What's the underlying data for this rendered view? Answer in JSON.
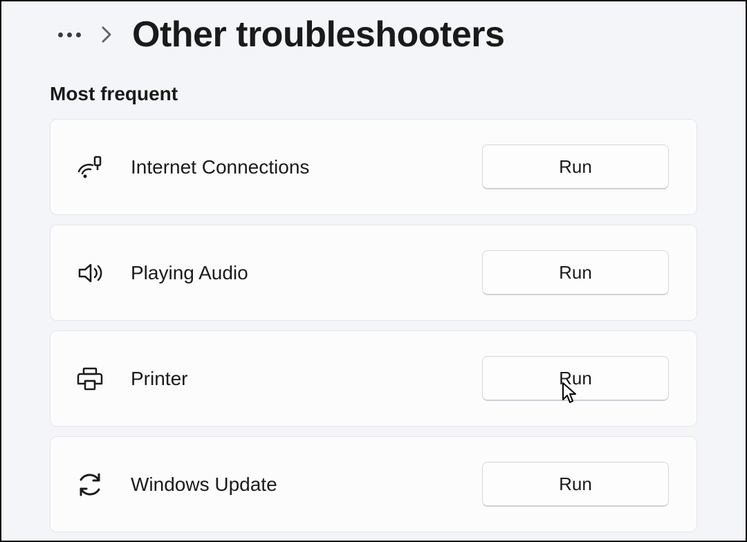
{
  "header": {
    "title": "Other troubleshooters"
  },
  "section": {
    "heading": "Most frequent",
    "items": [
      {
        "icon": "wifi-icon",
        "label": "Internet Connections",
        "run": "Run"
      },
      {
        "icon": "speaker-icon",
        "label": "Playing Audio",
        "run": "Run"
      },
      {
        "icon": "printer-icon",
        "label": "Printer",
        "run": "Run"
      },
      {
        "icon": "update-icon",
        "label": "Windows Update",
        "run": "Run"
      }
    ]
  }
}
